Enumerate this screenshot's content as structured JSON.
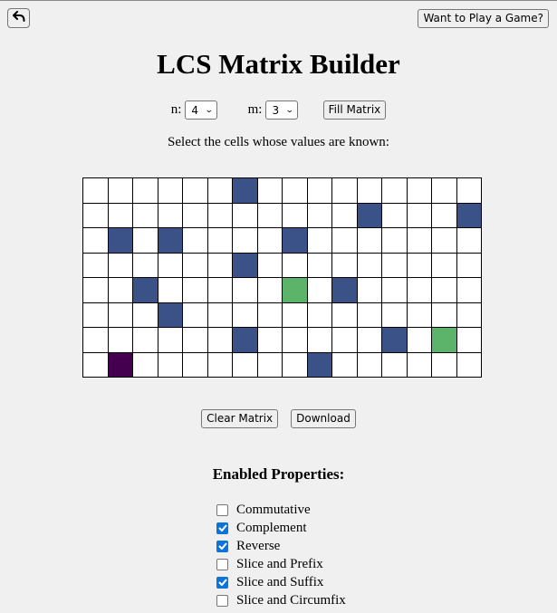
{
  "header": {
    "back_icon": "undo-arrow-icon",
    "play_button_label": "Want to Play a Game?"
  },
  "title": "LCS Matrix Builder",
  "controls": {
    "n_label": "n:",
    "n_value": "4",
    "m_label": "m:",
    "m_value": "3",
    "fill_button_label": "Fill Matrix"
  },
  "instruction": "Select the cells whose values are known:",
  "matrix": {
    "rows": 8,
    "cols": 16,
    "colors": {
      "empty": "#ffffff",
      "blue": "#3a5287",
      "green": "#5cb46a",
      "purple": "#44004f"
    },
    "cells": [
      {
        "row": 0,
        "col": 6,
        "color": "blue"
      },
      {
        "row": 1,
        "col": 11,
        "color": "blue"
      },
      {
        "row": 1,
        "col": 15,
        "color": "blue"
      },
      {
        "row": 2,
        "col": 1,
        "color": "blue"
      },
      {
        "row": 2,
        "col": 3,
        "color": "blue"
      },
      {
        "row": 2,
        "col": 8,
        "color": "blue"
      },
      {
        "row": 3,
        "col": 6,
        "color": "blue"
      },
      {
        "row": 4,
        "col": 2,
        "color": "blue"
      },
      {
        "row": 4,
        "col": 8,
        "color": "green"
      },
      {
        "row": 4,
        "col": 10,
        "color": "blue"
      },
      {
        "row": 5,
        "col": 3,
        "color": "blue"
      },
      {
        "row": 6,
        "col": 6,
        "color": "blue"
      },
      {
        "row": 6,
        "col": 12,
        "color": "blue"
      },
      {
        "row": 6,
        "col": 14,
        "color": "green"
      },
      {
        "row": 7,
        "col": 1,
        "color": "purple"
      },
      {
        "row": 7,
        "col": 9,
        "color": "blue"
      }
    ]
  },
  "actions": {
    "clear_label": "Clear Matrix",
    "download_label": "Download"
  },
  "properties": {
    "heading": "Enabled Properties:",
    "items": [
      {
        "label": "Commutative",
        "checked": false
      },
      {
        "label": "Complement",
        "checked": true
      },
      {
        "label": "Reverse",
        "checked": true
      },
      {
        "label": "Slice and Prefix",
        "checked": false
      },
      {
        "label": "Slice and Suffix",
        "checked": true
      },
      {
        "label": "Slice and Circumfix",
        "checked": false
      }
    ]
  }
}
